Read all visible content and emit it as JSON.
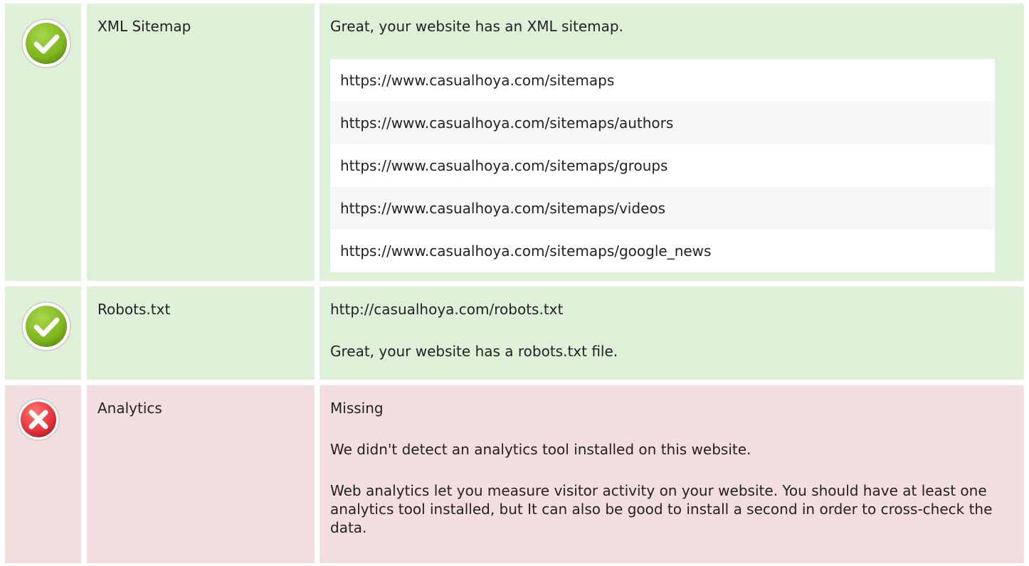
{
  "colors": {
    "good_background": "#dff0d8",
    "bad_background": "#f2dedf",
    "good_icon": "#7fb71d",
    "bad_icon": "#e6313b"
  },
  "rows": {
    "sitemap": {
      "status": "good",
      "status_icon": "check-circle-icon",
      "name": "XML Sitemap",
      "summary": "Great, your website has an XML sitemap.",
      "urls": [
        "https://www.casualhoya.com/sitemaps",
        "https://www.casualhoya.com/sitemaps/authors",
        "https://www.casualhoya.com/sitemaps/groups",
        "https://www.casualhoya.com/sitemaps/videos",
        "https://www.casualhoya.com/sitemaps/google_news"
      ]
    },
    "robots": {
      "status": "good",
      "status_icon": "check-circle-icon",
      "name": "Robots.txt",
      "url": "http://casualhoya.com/robots.txt",
      "summary": "Great, your website has a robots.txt file."
    },
    "analytics": {
      "status": "bad",
      "status_icon": "cross-circle-icon",
      "name": "Analytics",
      "status_text": "Missing",
      "summary": "We didn't detect an analytics tool installed on this website.",
      "explanation": "Web analytics let you measure visitor activity on your website. You should have at least one analytics tool installed, but It can also be good to install a second in order to cross-check the data."
    }
  }
}
